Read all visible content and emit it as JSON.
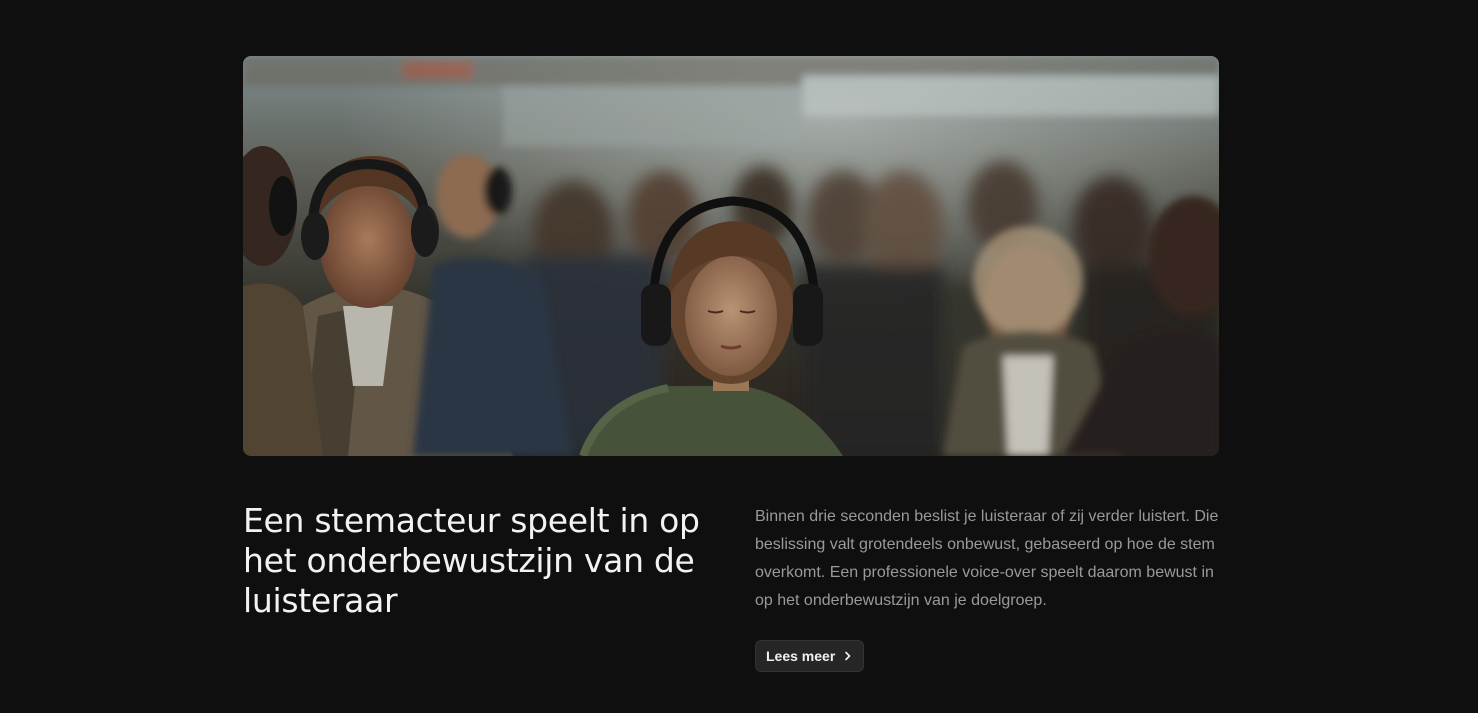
{
  "feature": {
    "image_icon": "crowd-headphones-photo",
    "headline": "Een stemacteur speelt in op het onderbewustzijn van de luisteraar",
    "body": "Binnen drie seconden beslist je luisteraar of zij verder luistert. Die beslissing valt grotendeels onbewust, gebaseerd op hoe de stem overkomt. Een professionele voice-over speelt daarom bewust in op het onderbewustzijn van je doelgroep.",
    "button_label": "Lees meer",
    "button_icon": "chevron-right-icon"
  },
  "colors": {
    "background": "#0f0f0f",
    "headline": "#f2f2f2",
    "body": "#9a9a9a",
    "button_bg": "#262626"
  }
}
